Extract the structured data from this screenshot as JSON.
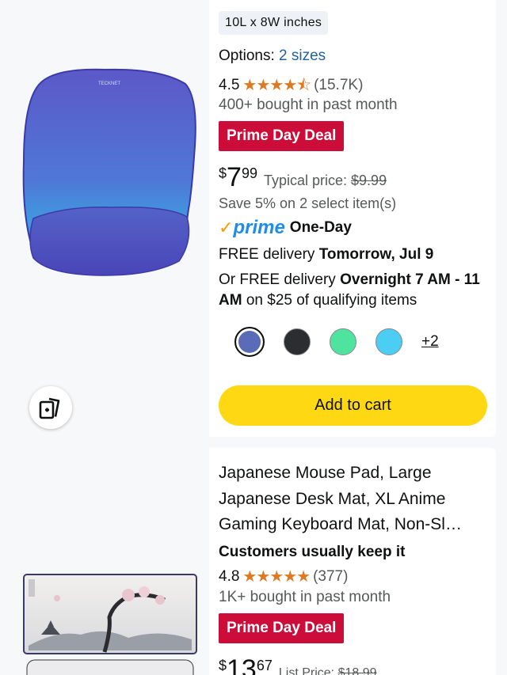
{
  "product1": {
    "size_chip": "10L x 8W inches",
    "options_label": "Options:",
    "options_link": "2 sizes",
    "rating": "4.5",
    "stars": "★★★★⯪",
    "review_count": "(15.7K)",
    "bought": "400+ bought in past month",
    "deal_badge": "Prime Day Deal",
    "price_symbol": "$",
    "price_whole": "7",
    "price_fraction": "99",
    "typical_label": "Typical price:",
    "typical_price": "$9.99",
    "save_text": "Save 5% on 2 select item(s)",
    "prime_word": "prime",
    "prime_speed": "One-Day",
    "delivery1_prefix": "FREE delivery ",
    "delivery1_bold": "Tomorrow, Jul 9",
    "delivery2_prefix": "Or FREE delivery ",
    "delivery2_bold": "Overnight 7 AM - 11 AM",
    "delivery2_suffix": " on $25 of qualifying items",
    "swatch_colors": [
      "#5a6bb8",
      "#2b2d31",
      "#4fe3a0",
      "#4ccdf4"
    ],
    "more_colors": "+2",
    "add_to_cart": "Add to cart",
    "pad_brand": "TECKNET",
    "compare_icon": "add-to-compare-icon"
  },
  "product2": {
    "title": "Japanese Mouse Pad, Large Japanese Desk Mat, XL Anime Gaming Keyboard Mat, Non-Sl…",
    "keep_text": "Customers usually keep it",
    "rating": "4.8",
    "stars": "★★★★★",
    "review_count": "(377)",
    "bought": "1K+ bought in past month",
    "deal_badge": "Prime Day Deal",
    "price_symbol": "$",
    "price_whole": "13",
    "price_fraction": "67",
    "list_label": "List Price:",
    "list_price": "$18.99"
  },
  "colors": {
    "deal_red": "#cc0c39",
    "cart_yellow": "#ffd814",
    "link_blue": "#2162a1",
    "star_orange": "#de7921",
    "prime_blue": "#1f8ce6"
  }
}
